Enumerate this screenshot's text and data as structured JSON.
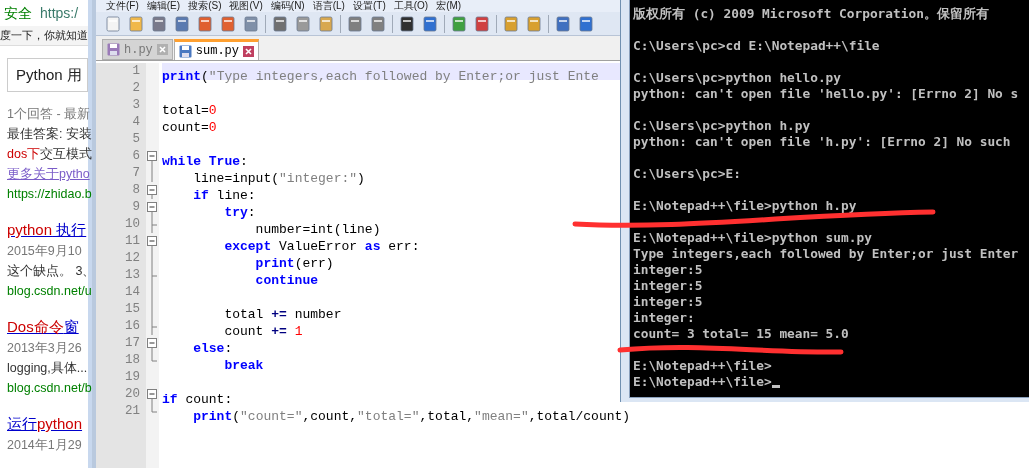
{
  "browser": {
    "security_label": "安全",
    "url": "https:/",
    "slogan": "度一下，你就知道",
    "search_value": "Python 用",
    "results": [
      {
        "lines": [
          {
            "kind": "meta",
            "parts": [
              {
                "text": "1个回答 - 最新",
                "hit": false
              }
            ]
          },
          {
            "kind": "snippet",
            "parts": [
              {
                "text": "最佳答案: 安装",
                "hit": false
              }
            ]
          },
          {
            "kind": "snippet",
            "parts": [
              {
                "text": "dos下",
                "hit": true
              },
              {
                "text": "交互模式",
                "hit": false
              }
            ]
          },
          {
            "kind": "link",
            "parts": [
              {
                "text": "更多关于pytho",
                "hit": false
              }
            ]
          },
          {
            "kind": "url",
            "parts": [
              {
                "text": "https://zhidao.b",
                "hit": false
              }
            ]
          }
        ]
      },
      {
        "title": [
          {
            "text": "python",
            "hit": true
          },
          {
            "text": " 执行",
            "hit": false
          }
        ],
        "lines": [
          {
            "kind": "meta",
            "parts": [
              {
                "text": "2015年9月10",
                "hit": false
              }
            ]
          },
          {
            "kind": "snippet",
            "parts": [
              {
                "text": "这个缺点。 3、",
                "hit": false
              }
            ]
          },
          {
            "kind": "url",
            "parts": [
              {
                "text": "blog.csdn.net/u",
                "hit": false
              }
            ]
          }
        ]
      },
      {
        "title": [
          {
            "text": "Dos命令",
            "hit": true
          },
          {
            "text": "窗",
            "hit": false
          }
        ],
        "lines": [
          {
            "kind": "meta",
            "parts": [
              {
                "text": "2013年3月26",
                "hit": false
              }
            ]
          },
          {
            "kind": "snippet",
            "parts": [
              {
                "text": "logging,具体...",
                "hit": false
              }
            ]
          },
          {
            "kind": "url",
            "parts": [
              {
                "text": "blog.csdn.net/b",
                "hit": false
              }
            ]
          }
        ]
      },
      {
        "title": [
          {
            "text": "运行",
            "hit": false
          },
          {
            "text": "python",
            "hit": true
          }
        ],
        "lines": [
          {
            "kind": "meta",
            "parts": [
              {
                "text": "2014年1月29",
                "hit": false
              }
            ]
          }
        ]
      }
    ]
  },
  "editor": {
    "menu": [
      "文件(F)",
      "编辑(E)",
      "搜索(S)",
      "视图(V)",
      "编码(N)",
      "语言(L)",
      "设置(T)",
      "工具(O)",
      "宏(M)"
    ],
    "tabs": [
      {
        "label": "h.py",
        "selected": false
      },
      {
        "label": "sum.py",
        "selected": true
      }
    ],
    "lines": [
      {
        "number": "1",
        "current": true,
        "tokens": [
          {
            "kind": "kw",
            "text": "print"
          },
          {
            "kind": "plain",
            "text": "("
          },
          {
            "kind": "str",
            "text": "\"Type integers,each followed by Enter;or just Ente"
          }
        ]
      },
      {
        "number": "2",
        "current": false
      },
      {
        "number": "3",
        "current": false,
        "tokens": [
          {
            "kind": "plain",
            "text": "total="
          },
          {
            "kind": "num",
            "text": "0"
          }
        ]
      },
      {
        "number": "4",
        "current": false,
        "tokens": [
          {
            "kind": "plain",
            "text": "count="
          },
          {
            "kind": "num",
            "text": "0"
          }
        ]
      },
      {
        "number": "5",
        "current": false
      },
      {
        "number": "6",
        "kind": "open",
        "current": false,
        "tokens": [
          {
            "kind": "kw",
            "text": "while"
          },
          {
            "kind": "kw",
            "text": " True"
          },
          {
            "kind": "plain",
            "text": ":"
          }
        ]
      },
      {
        "number": "7",
        "kind": "bar",
        "current": false,
        "tokens": [
          {
            "kind": "plain",
            "text": "    line=input("
          },
          {
            "kind": "str",
            "text": "\"integer:\""
          },
          {
            "kind": "plain",
            "text": ")"
          }
        ]
      },
      {
        "number": "8",
        "kind": "open",
        "current": false,
        "tokens": [
          {
            "kind": "kw",
            "text": "    if"
          },
          {
            "kind": "plain",
            "text": " line:"
          }
        ]
      },
      {
        "number": "9",
        "kind": "open",
        "current": false,
        "tokens": [
          {
            "kind": "kw",
            "text": "        try"
          },
          {
            "kind": "plain",
            "text": ":"
          }
        ]
      },
      {
        "number": "10",
        "kind": "branch",
        "current": false,
        "tokens": [
          {
            "kind": "plain",
            "text": "            number=int(line)"
          }
        ]
      },
      {
        "number": "11",
        "kind": "open",
        "current": false,
        "tokens": [
          {
            "kind": "kw",
            "text": "        except"
          },
          {
            "kind": "plain",
            "text": " ValueError "
          },
          {
            "kind": "kw",
            "text": "as"
          },
          {
            "kind": "plain",
            "text": " err:"
          }
        ]
      },
      {
        "number": "12",
        "kind": "bar",
        "current": false,
        "tokens": [
          {
            "kind": "kw",
            "text": "            print"
          },
          {
            "kind": "plain",
            "text": "(err)"
          }
        ]
      },
      {
        "number": "13",
        "kind": "branch",
        "current": false,
        "tokens": [
          {
            "kind": "kw",
            "text": "            continue"
          }
        ]
      },
      {
        "number": "14",
        "kind": "bar",
        "current": false
      },
      {
        "number": "15",
        "kind": "bar",
        "current": false,
        "tokens": [
          {
            "kind": "plain",
            "text": "        total "
          },
          {
            "kind": "op",
            "text": "+="
          },
          {
            "kind": "plain",
            "text": " number"
          }
        ]
      },
      {
        "number": "16",
        "kind": "branch",
        "current": false,
        "tokens": [
          {
            "kind": "plain",
            "text": "        count "
          },
          {
            "kind": "op",
            "text": "+="
          },
          {
            "kind": "num",
            "text": " 1"
          }
        ]
      },
      {
        "number": "17",
        "kind": "open",
        "current": false,
        "tokens": [
          {
            "kind": "kw",
            "text": "    else"
          },
          {
            "kind": "plain",
            "text": ":"
          }
        ]
      },
      {
        "number": "18",
        "kind": "end",
        "current": false,
        "tokens": [
          {
            "kind": "kw",
            "text": "        break"
          }
        ]
      },
      {
        "number": "19",
        "current": false
      },
      {
        "number": "20",
        "kind": "open",
        "current": false,
        "tokens": [
          {
            "kind": "kw",
            "text": "if"
          },
          {
            "kind": "plain",
            "text": " count:"
          }
        ]
      },
      {
        "number": "21",
        "kind": "end",
        "current": false,
        "tokens": [
          {
            "kind": "kw",
            "text": "    print"
          },
          {
            "kind": "plain",
            "text": "("
          },
          {
            "kind": "str",
            "text": "\"count=\""
          },
          {
            "kind": "plain",
            "text": ",count,"
          },
          {
            "kind": "str",
            "text": "\"total=\""
          },
          {
            "kind": "plain",
            "text": ",total,"
          },
          {
            "kind": "str",
            "text": "\"mean=\""
          },
          {
            "kind": "plain",
            "text": ",total/count)"
          }
        ]
      }
    ]
  },
  "console": {
    "cursor_visible": true,
    "blocks": [
      [
        "版权所有 (c) 2009 Microsoft Corporation。保留所有"
      ],
      [
        "C:\\Users\\pc>cd E:\\Notepad++\\file"
      ],
      [
        "C:\\Users\\pc>python hello.py",
        "python: can't open file 'hello.py': [Errno 2] No s"
      ],
      [
        "C:\\Users\\pc>python h.py",
        "python: can't open file 'h.py': [Errno 2] No such"
      ],
      [
        "C:\\Users\\pc>E:"
      ],
      [
        "E:\\Notepad++\\file>python h.py"
      ],
      [
        "E:\\Notepad++\\file>python sum.py",
        "Type integers,each followed by Enter;or just Enter",
        "integer:5",
        "integer:5",
        "integer:5",
        "integer:",
        "count= 3 total= 15 mean= 5.0"
      ],
      [
        "E:\\Notepad++\\file>",
        "E:\\Notepad++\\file>"
      ]
    ]
  }
}
